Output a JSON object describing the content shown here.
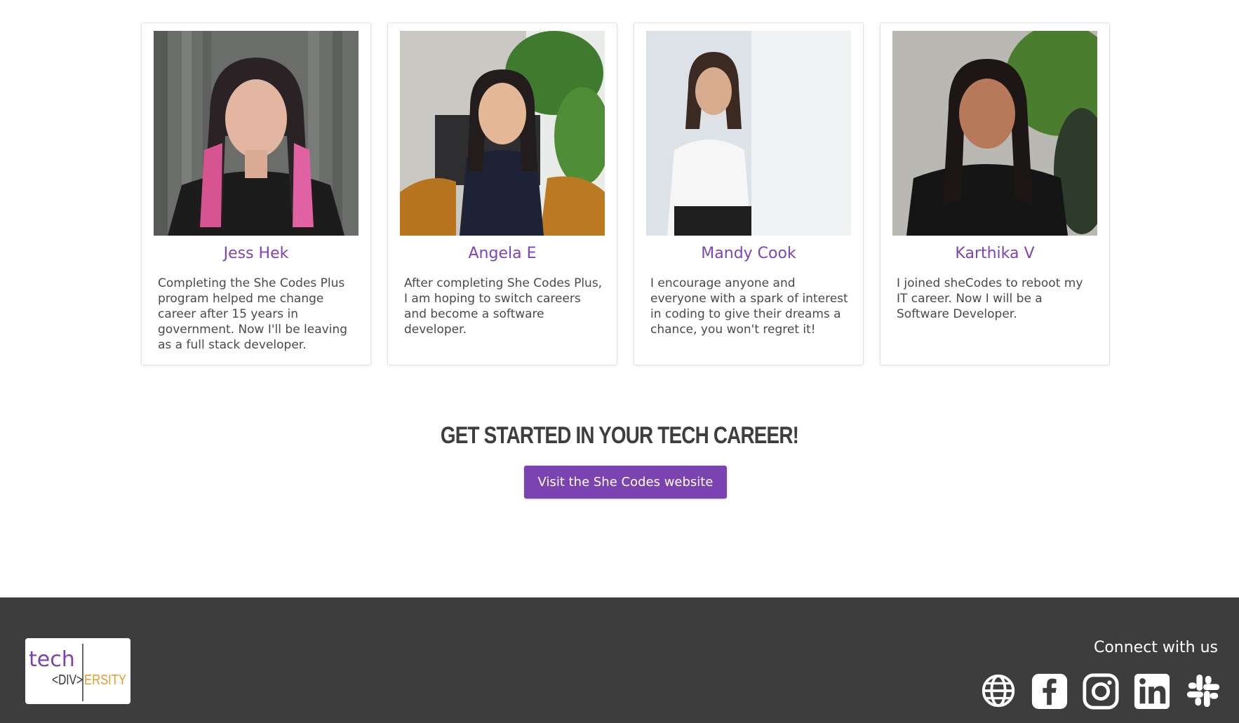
{
  "testimonials": [
    {
      "name": "Jess Hek",
      "quote": "Completing the She Codes Plus program helped me change career after 15 years in government. Now I'll be leaving as a full stack developer."
    },
    {
      "name": "Angela E",
      "quote": "After completing She Codes Plus, I am hoping to switch careers and become a software developer."
    },
    {
      "name": "Mandy Cook",
      "quote": "I encourage anyone and everyone with a spark of interest in coding to give their dreams a chance, you won't regret it!"
    },
    {
      "name": "Karthika V",
      "quote": "I joined sheCodes to reboot my IT career. Now I will be a Software Developer."
    }
  ],
  "cta": {
    "title": "GET STARTED IN YOUR TECH CAREER!",
    "button_label": "Visit the She Codes website"
  },
  "footer": {
    "logo_text": "tech <DIV>ERSITY",
    "connect_label": "Connect with us",
    "social_icons": [
      "globe-icon",
      "facebook-icon",
      "instagram-icon",
      "linkedin-icon",
      "slack-icon"
    ]
  },
  "colors": {
    "accent": "#7b43b1",
    "name_color": "#7d45b3",
    "footer_bg": "#3d3d3d",
    "logo_orange": "#e59c2b"
  }
}
